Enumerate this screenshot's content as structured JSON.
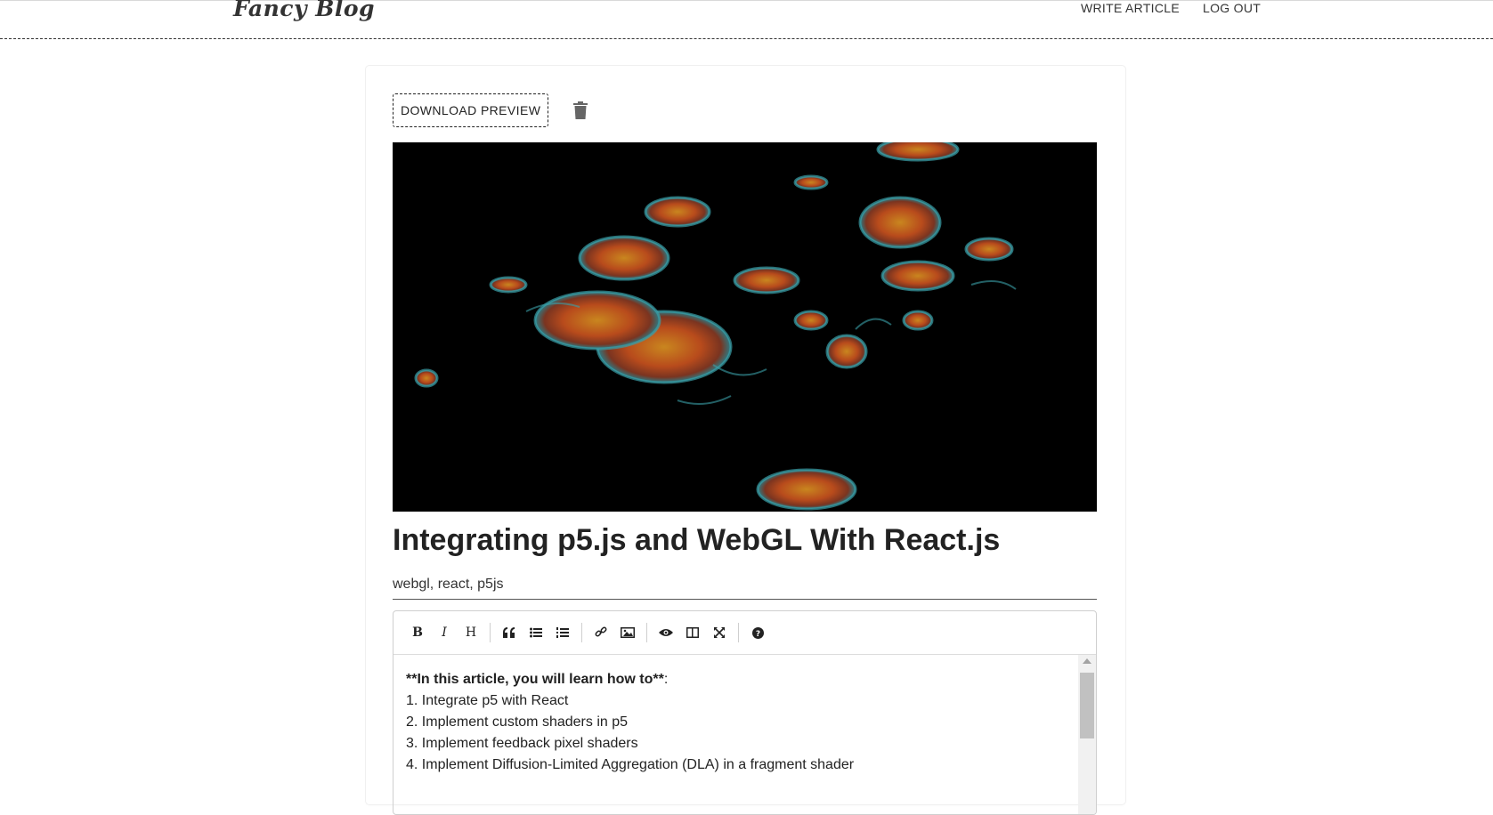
{
  "header": {
    "brand": "Fancy Blog",
    "nav": [
      "WRITE ARTICLE",
      "LOG OUT"
    ]
  },
  "article": {
    "download_label": "DOWNLOAD PREVIEW",
    "delete_icon": "trash-icon",
    "title": "Integrating p5.js and WebGL With React.js",
    "tags": "webgl, react, p5js",
    "editor": {
      "toolbar": [
        "bold",
        "italic",
        "heading",
        "quote",
        "unordered-list",
        "ordered-list",
        "link",
        "image",
        "preview",
        "side-by-side",
        "fullscreen",
        "guide"
      ],
      "intro_bold": "**In this article, you will learn how to**",
      "intro_suffix": ":",
      "lines": [
        "1. Integrate p5 with React",
        "2. Implement custom shaders in p5",
        "3. Implement feedback pixel shaders",
        "4. Implement Diffusion-Limited Aggregation (DLA) in a fragment shader"
      ]
    }
  },
  "colors": {
    "cover_bg": "#000000",
    "blob_core": "#c0541c",
    "blob_rim": "#3aa0a8"
  }
}
